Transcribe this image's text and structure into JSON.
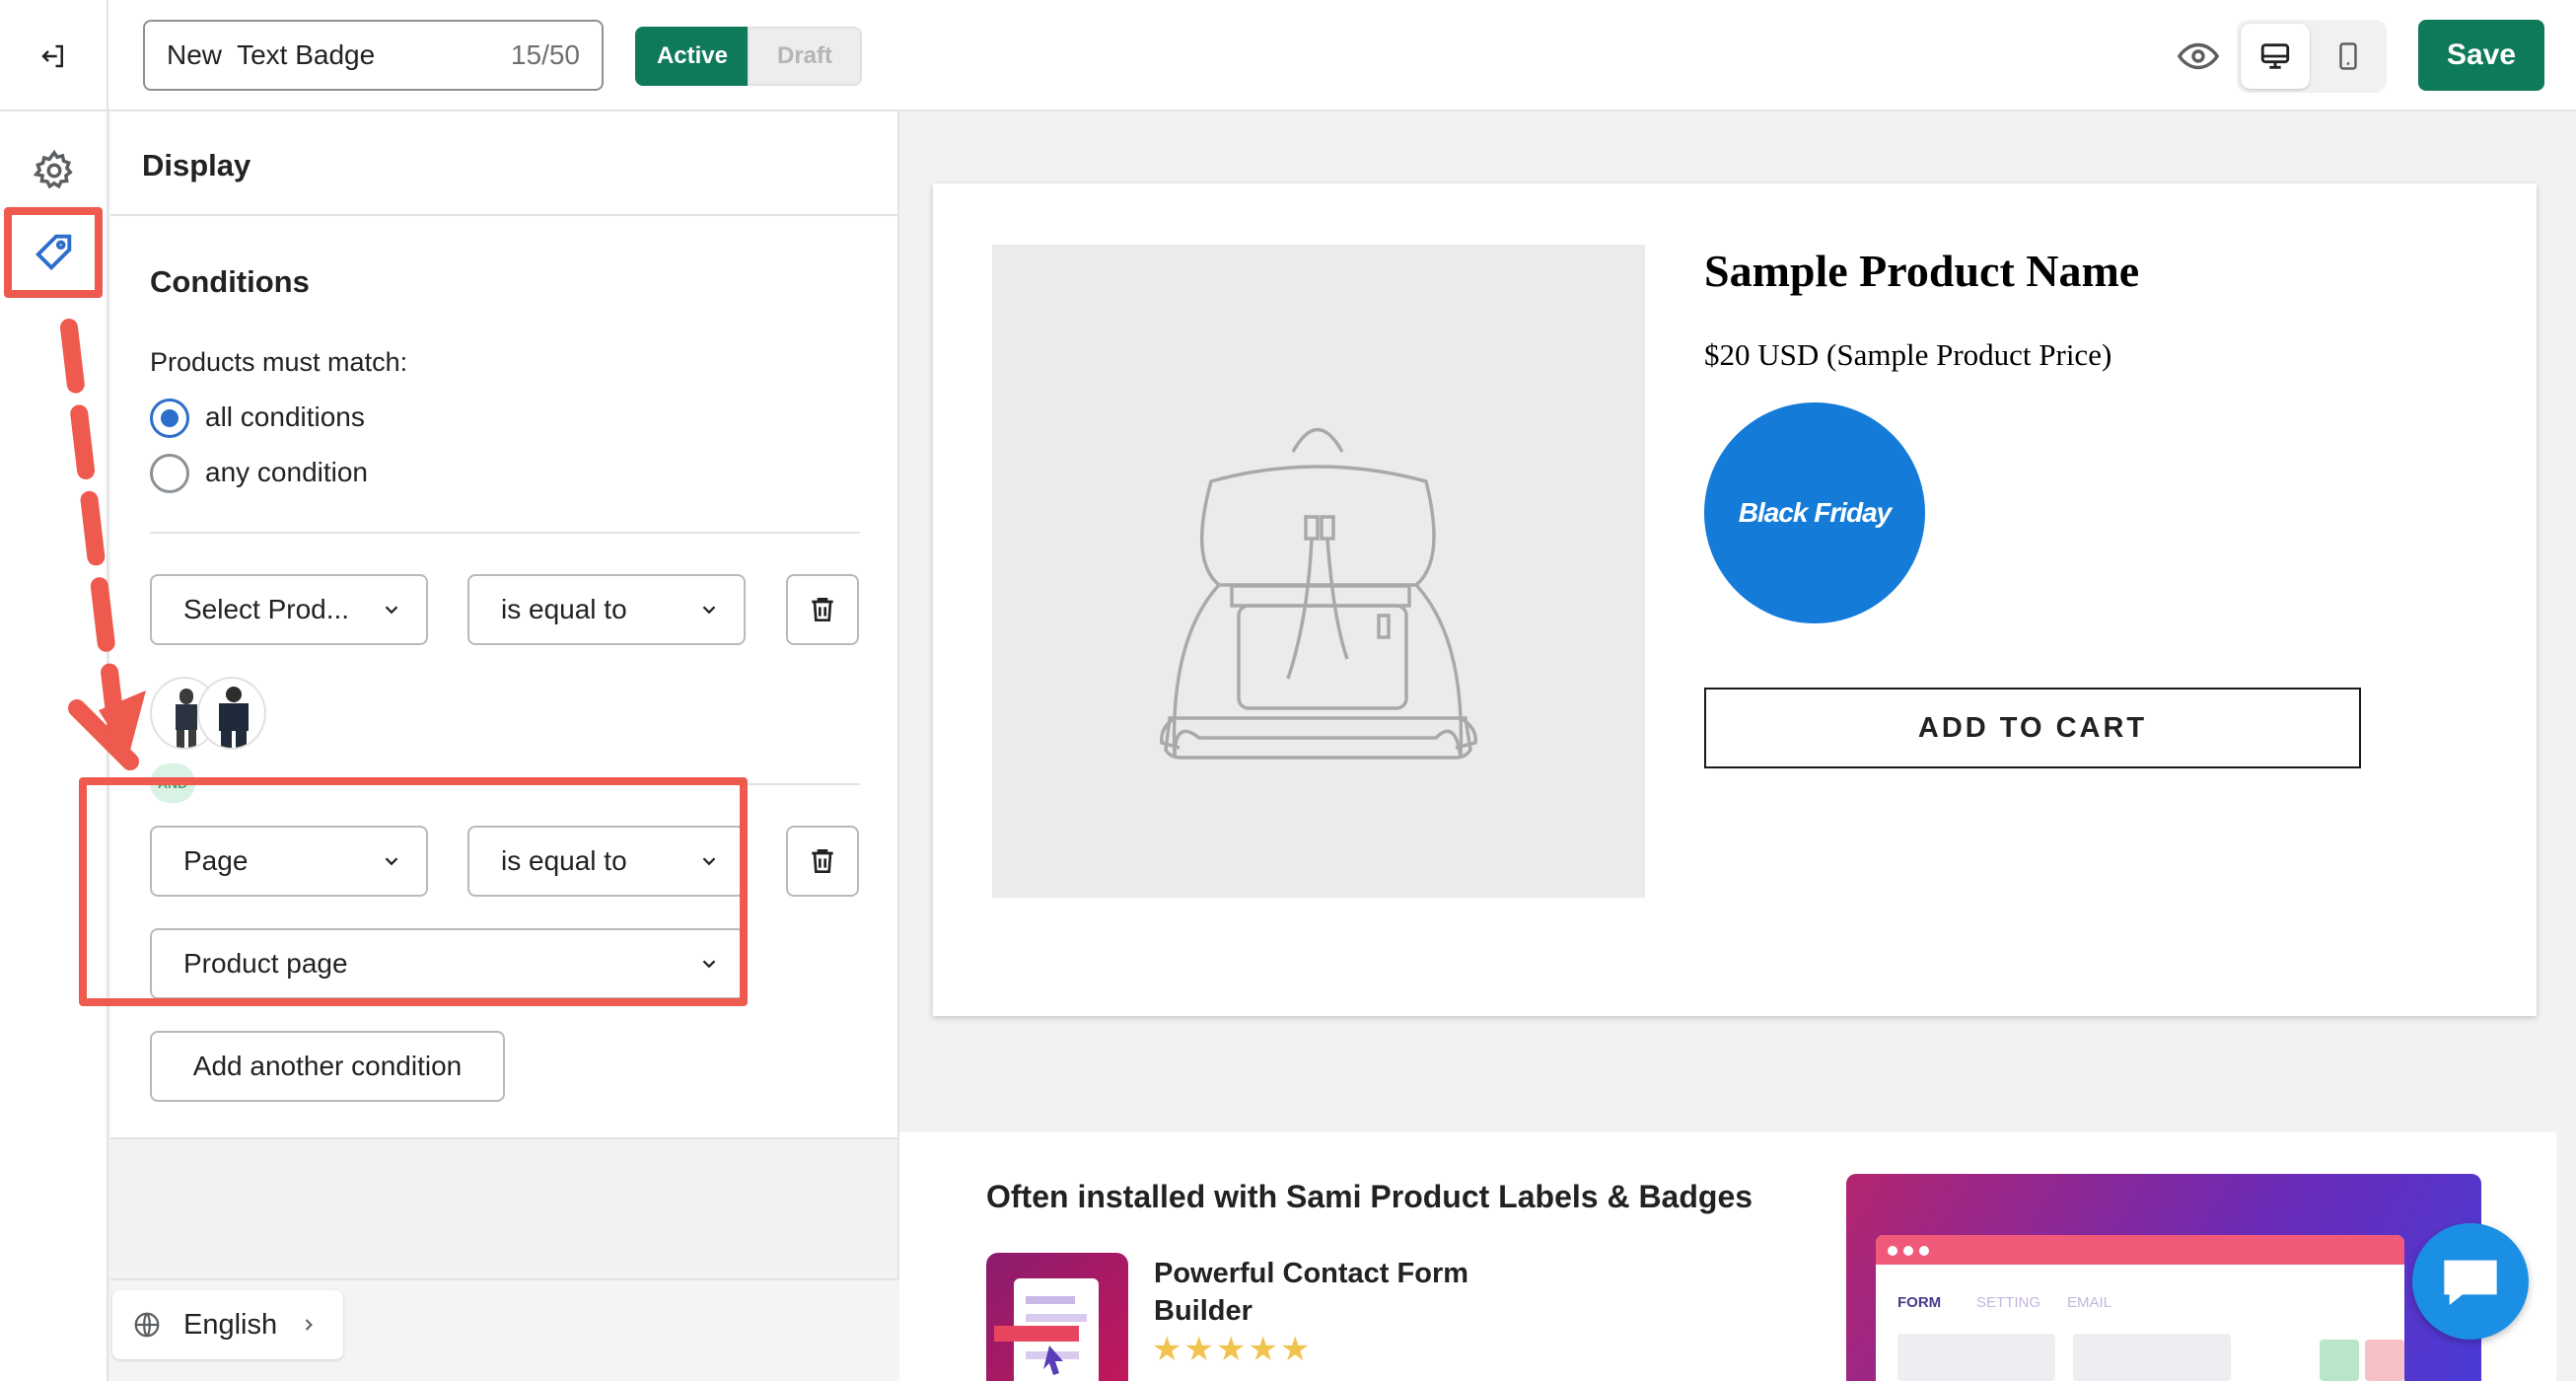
{
  "header": {
    "title_value": "New  Text Badge",
    "title_count": "15/50",
    "status_active": "Active",
    "status_draft": "Draft",
    "save_label": "Save"
  },
  "panel": {
    "heading": "Display",
    "section_title": "Conditions",
    "match_label": "Products must match:",
    "match_options": [
      "all conditions",
      "any condition"
    ],
    "selected_match": "all conditions"
  },
  "conditions": [
    {
      "field": "Select Prod...",
      "operator": "is equal to"
    },
    {
      "field": "Page",
      "operator": "is equal to",
      "value": "Product page"
    }
  ],
  "and_label": "AND",
  "add_condition_label": "Add another condition",
  "language": "English",
  "preview": {
    "product_name": "Sample Product Name",
    "product_price": "$20 USD (Sample Product Price)",
    "badge_text": "Black Friday",
    "cart_label": "ADD TO CART"
  },
  "promo": {
    "title": "Often installed with Sami Product Labels & Badges",
    "app_name": "Powerful Contact Form Builder",
    "rating": 5,
    "shot_tabs": [
      "FORM",
      "SETTING",
      "EMAIL"
    ]
  },
  "colors": {
    "primary": "#0f7a5a",
    "badge": "#147cd8",
    "highlight": "#ef5a4e",
    "radio": "#2c6ecb",
    "chat": "#1a8fe3"
  }
}
